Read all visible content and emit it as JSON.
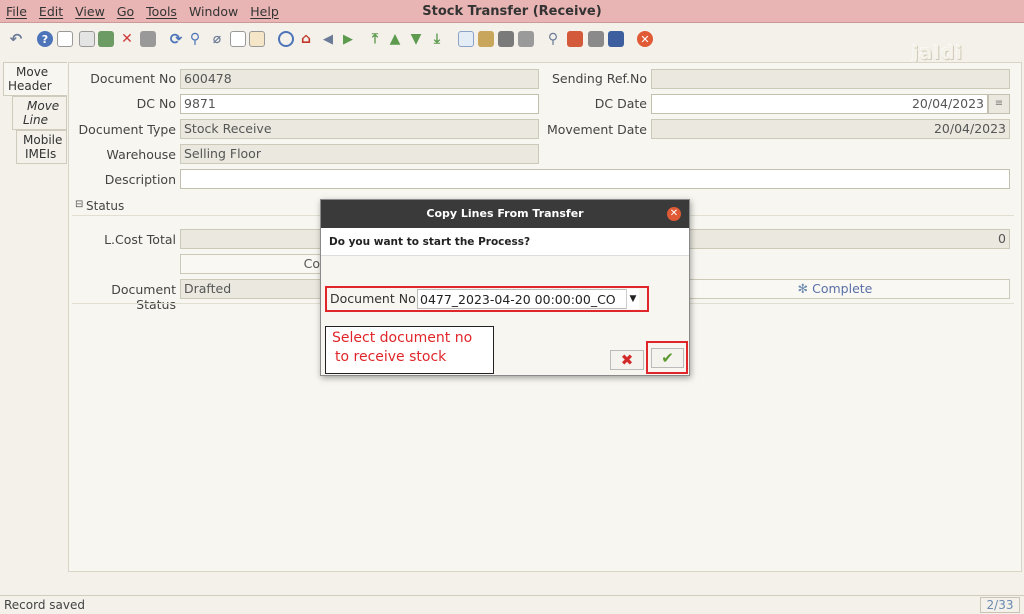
{
  "menu": [
    "File",
    "Edit",
    "View",
    "Go",
    "Tools",
    "Window",
    "Help"
  ],
  "window_title": "Stock Transfer (Receive)",
  "watermark": "jaldi",
  "tabs": [
    {
      "label_line1": "Move",
      "label_line2": "Header"
    },
    {
      "label_line1": "Move",
      "label_line2": "Line"
    },
    {
      "label_line1": "Mobile",
      "label_line2": "IMEIs"
    }
  ],
  "form": {
    "document_no": {
      "label": "Document No",
      "value": "600478"
    },
    "dc_no": {
      "label": "DC No",
      "value": "9871"
    },
    "document_type": {
      "label": "Document Type",
      "value": "Stock Receive"
    },
    "warehouse": {
      "label": "Warehouse",
      "value": "Selling Floor"
    },
    "description": {
      "label": "Description",
      "value": ""
    },
    "sending_ref_no": {
      "label": "Sending Ref.No",
      "value": ""
    },
    "dc_date": {
      "label": "DC Date",
      "value": "20/04/2023"
    },
    "movement_date": {
      "label": "Movement Date",
      "value": "20/04/2023"
    },
    "status_section": "Status",
    "l_cost_total": {
      "label": "L.Cost Total",
      "value": "0"
    },
    "copy_button_partial": "Co",
    "document_status": {
      "label": "Document Status",
      "value": "Drafted"
    },
    "complete_button": "Complete"
  },
  "dialog": {
    "title": "Copy Lines From Transfer",
    "question": "Do you want to start the Process?",
    "doc_label": "Document No",
    "doc_value": "0477_2023-04-20 00:00:00_CO",
    "annotation_line1": "Select document no",
    "annotation_line2": "to receive stock"
  },
  "status_bar": {
    "message": "Record saved",
    "page": "2/33"
  }
}
